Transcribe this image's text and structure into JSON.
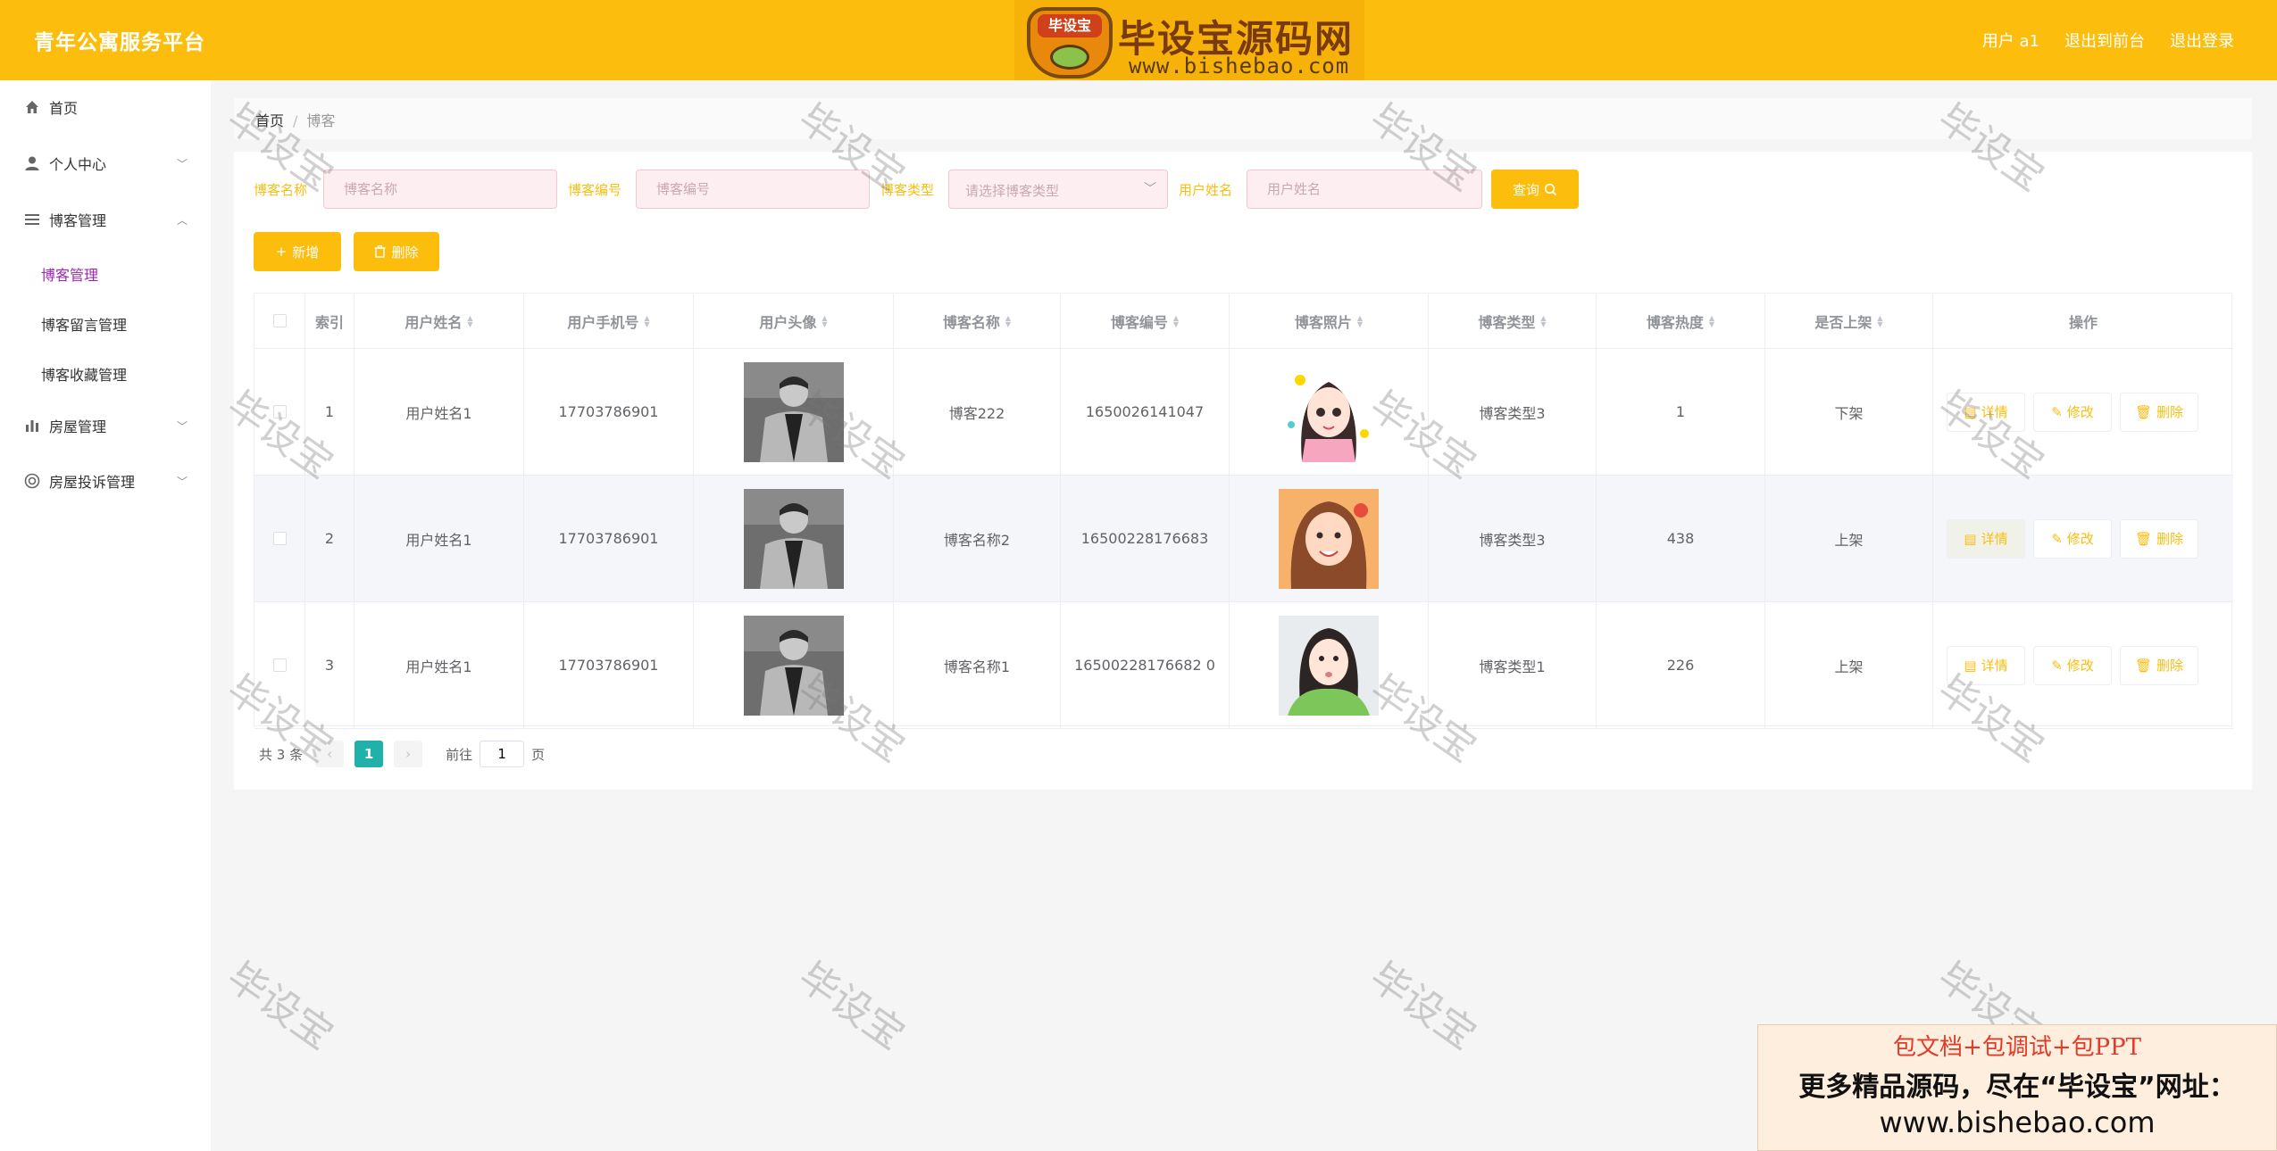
{
  "header": {
    "title": "青年公寓服务平台",
    "user": "用户 a1",
    "to_front": "退出到前台",
    "logout": "退出登录",
    "logo_badge": "毕设宝",
    "logo_text": "毕设宝源码网",
    "logo_url": "www.bishebao.com"
  },
  "sidebar": {
    "home": "首页",
    "personal": "个人中心",
    "blog_mgmt": "博客管理",
    "sub_blog": "博客管理",
    "sub_comments": "博客留言管理",
    "sub_favorites": "博客收藏管理",
    "house_mgmt": "房屋管理",
    "complaint_mgmt": "房屋投诉管理"
  },
  "breadcrumb": {
    "home": "首页",
    "sep": "/",
    "current": "博客"
  },
  "search": {
    "name_label": "博客名称",
    "name_placeholder": "博客名称",
    "code_label": "博客编号",
    "code_placeholder": "博客编号",
    "type_label": "博客类型",
    "type_placeholder": "请选择博客类型",
    "user_label": "用户姓名",
    "user_placeholder": "用户姓名",
    "query_button": "查询"
  },
  "toolbar": {
    "add": "新增",
    "delete": "删除"
  },
  "table": {
    "headers": [
      "索引",
      "用户姓名",
      "用户手机号",
      "用户头像",
      "博客名称",
      "博客编号",
      "博客照片",
      "博客类型",
      "博客热度",
      "是否上架",
      "操作"
    ],
    "rows": [
      {
        "index": "1",
        "user": "用户姓名1",
        "phone": "17703786901",
        "blog_name": "博客222",
        "code": "1650026141047",
        "type": "博客类型3",
        "heat": "1",
        "shelf": "下架"
      },
      {
        "index": "2",
        "user": "用户姓名1",
        "phone": "17703786901",
        "blog_name": "博客名称2",
        "code": "16500228176683",
        "type": "博客类型3",
        "heat": "438",
        "shelf": "上架"
      },
      {
        "index": "3",
        "user": "用户姓名1",
        "phone": "17703786901",
        "blog_name": "博客名称1",
        "code": "16500228176682 0",
        "type": "博客类型1",
        "heat": "226",
        "shelf": "上架"
      }
    ],
    "op_detail": "详情",
    "op_edit": "修改",
    "op_delete": "删除"
  },
  "pagination": {
    "total": "共 3 条",
    "current_page": "1",
    "goto_label": "前往",
    "goto_value": "1",
    "page_suffix": "页"
  },
  "watermark": "毕设宝",
  "ad": {
    "line1": "包文档+包调试+包PPT",
    "line2": "更多精品源码，尽在“毕设宝”网址：",
    "line3": "www.bishebao.com"
  },
  "colors": {
    "primary": "#fdbd0d",
    "active_menu": "#9c27b0",
    "page_active": "#20b2aa"
  }
}
